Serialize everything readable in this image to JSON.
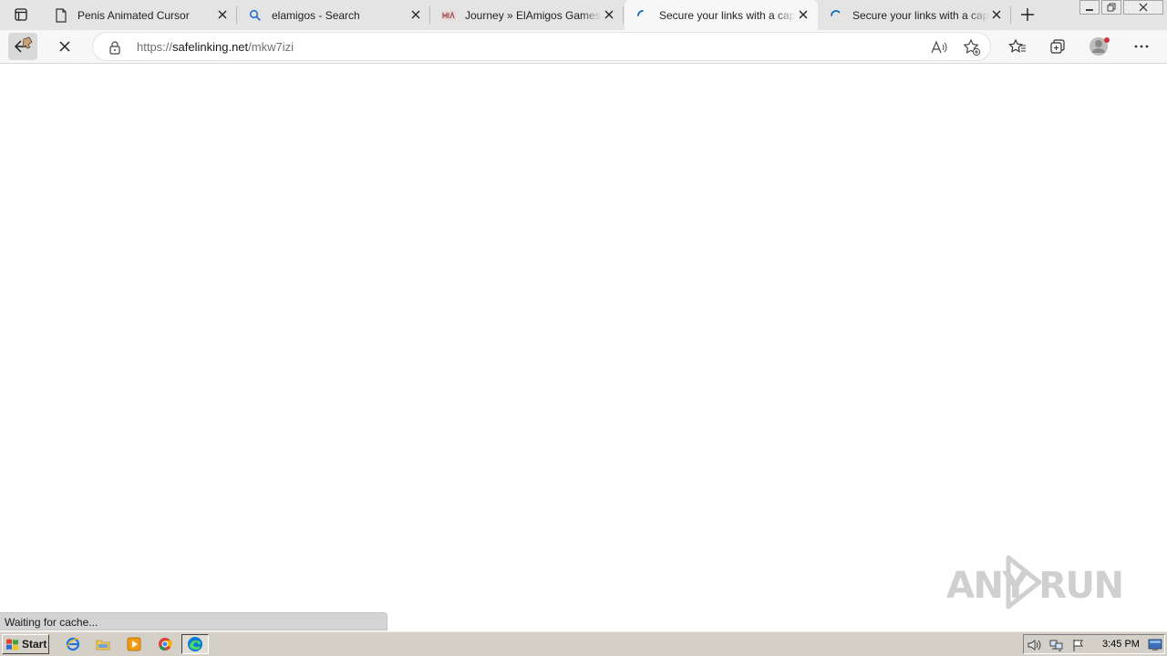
{
  "browser": {
    "tabs": [
      {
        "title": "Penis Animated Cursor",
        "favicon": "page-icon",
        "active": false
      },
      {
        "title": "elamigos - Search",
        "favicon": "search-icon",
        "active": false
      },
      {
        "title": "Journey » ElAmigos Games",
        "favicon": "site-logo-icon",
        "active": false
      },
      {
        "title": "Secure your links with a captcha",
        "favicon": "loading-spinner-icon",
        "active": true
      },
      {
        "title": "Secure your links with a captcha",
        "favicon": "loading-spinner-icon",
        "active": false
      }
    ],
    "address": {
      "scheme": "https://",
      "host": "safelinking.net",
      "path": "/mkw7izi"
    },
    "status_text": "Waiting for cache..."
  },
  "watermark": {
    "text": "ANY RUN"
  },
  "taskbar": {
    "start_label": "Start",
    "clock": "3:45 PM"
  },
  "colors": {
    "accent": "#0f6cbd",
    "tab_strip": "#e4e4e4",
    "taskbar": "#d4d0c8"
  }
}
